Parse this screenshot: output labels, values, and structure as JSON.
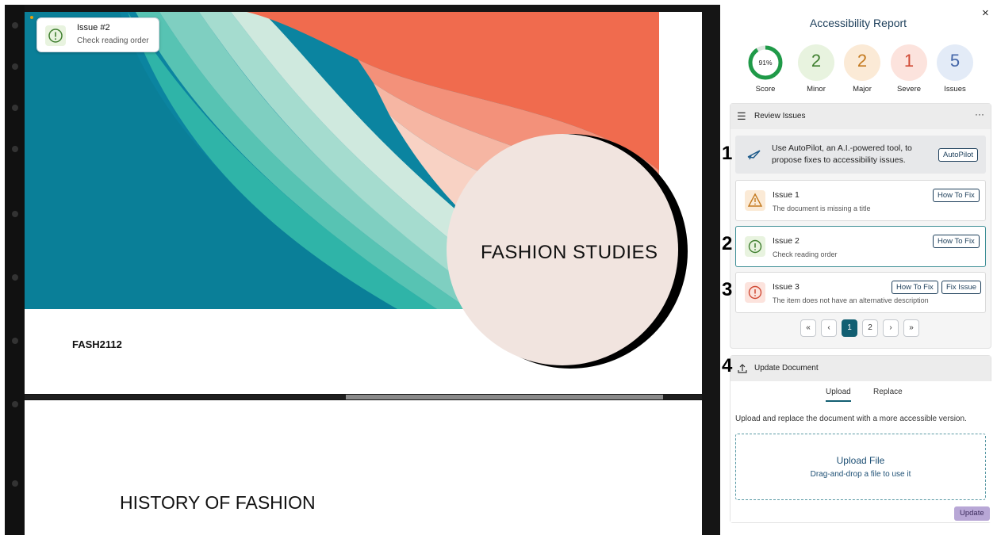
{
  "slides": {
    "slide1_title": "FASHION STUDIES",
    "slide1_code": "FASH2112",
    "slide2_title": "HISTORY OF FASHION"
  },
  "tooltip": {
    "title": "Issue #2",
    "subtitle": "Check reading order",
    "icon": "info-circle-icon"
  },
  "report": {
    "title": "Accessibility Report",
    "close": "×",
    "scores": [
      {
        "value": "91%",
        "label": "Score",
        "color": "#1f9a48",
        "fraction": 0.91
      },
      {
        "value": "2",
        "label": "Minor",
        "color": "#3f7f2f",
        "bg": "#e8f3df"
      },
      {
        "value": "2",
        "label": "Major",
        "color": "#c47a20",
        "bg": "#fbead6"
      },
      {
        "value": "1",
        "label": "Severe",
        "color": "#d04a35",
        "bg": "#fce3dd"
      },
      {
        "value": "5",
        "label": "Issues",
        "color": "#4466a8",
        "bg": "#e3ebf7"
      }
    ],
    "review": {
      "heading": "Review Issues",
      "more": "···",
      "autopilot_text": "Use AutoPilot, an A.I.-powered tool, to propose fixes to accessibility issues.",
      "autopilot_button": "AutoPilot",
      "issues": [
        {
          "title": "Issue 1",
          "desc": "The document is missing a title",
          "severity": "major",
          "icon": "warning-triangle-icon"
        },
        {
          "title": "Issue 2",
          "desc": "Check reading order",
          "severity": "minor",
          "icon": "info-circle-icon"
        },
        {
          "title": "Issue 3",
          "desc": "The item does not have an alternative description",
          "severity": "severe",
          "icon": "error-circle-icon"
        }
      ],
      "how_to_fix": "How To Fix",
      "fix_issue": "Fix Issue",
      "pager": {
        "first": "«",
        "prev": "‹",
        "pages": [
          "1",
          "2"
        ],
        "next": "›",
        "last": "»",
        "current": "1"
      }
    },
    "update": {
      "heading": "Update Document",
      "tabs": [
        "Upload",
        "Replace"
      ],
      "active_tab": "Upload",
      "description": "Upload and replace the document with a more accessible version.",
      "dropzone_title": "Upload File",
      "dropzone_sub": "Drag-and-drop a file to use it",
      "button": "Update"
    }
  },
  "markers": [
    "1",
    "2",
    "3",
    "4"
  ]
}
